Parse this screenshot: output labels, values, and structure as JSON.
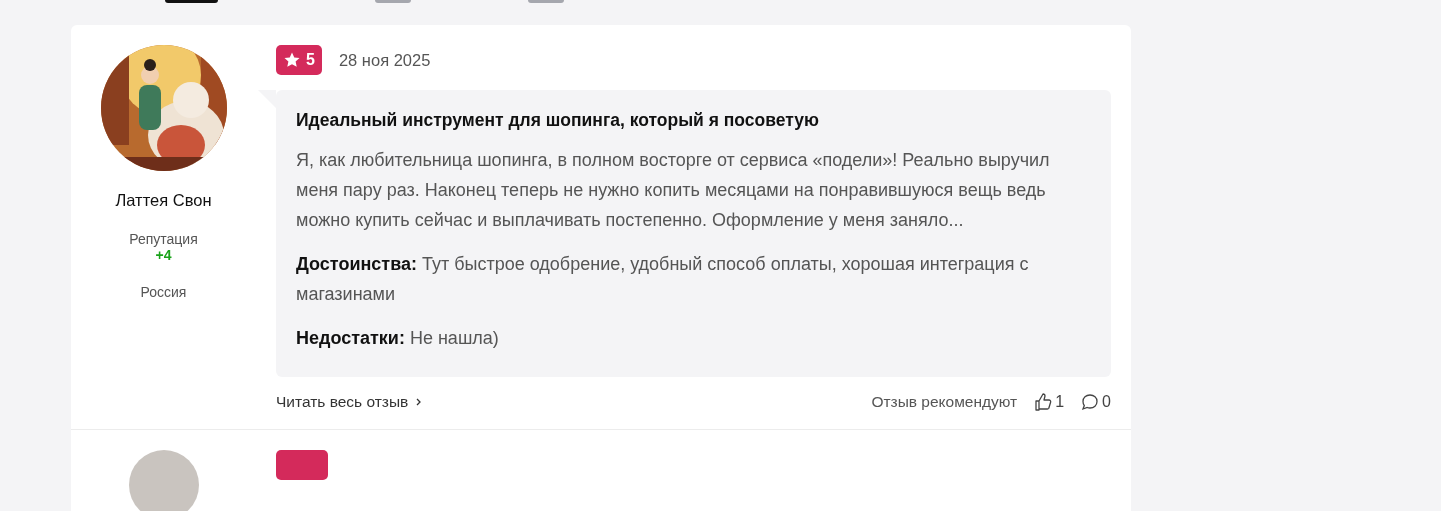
{
  "reviews": [
    {
      "author": {
        "name": "Латтея Свон",
        "reputation_label": "Репутация",
        "reputation": "+4",
        "country": "Россия"
      },
      "rating": "5",
      "date": "28 ноя 2025",
      "title": "Идеальный инструмент для шопинга, который я посоветую",
      "text": "Я, как любительница шопинга, в полном восторге от сервиса «подели»! Реально выручил меня пару раз. Наконец теперь не нужно копить месяцами на понравившуюся вещь ведь можно купить сейчас и выплачивать постепенно. Оформление у меня заняло...",
      "pros": "**Достоинства:** Тут быстрое одобрение, удобный способ оплаты, хорошая интеграция с магазинами",
      "cons": "**Недостатки:** Не нашла)",
      "read_more": "Читать весь отзыв",
      "recommend_label": "Отзыв рекомендуют",
      "likes": "1",
      "comments": "0"
    }
  ]
}
